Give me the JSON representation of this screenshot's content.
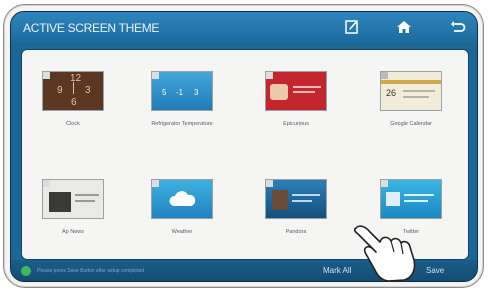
{
  "header": {
    "title": "ACTIVE SCREEN THEME",
    "icons": [
      "edit-icon",
      "home-icon",
      "back-icon"
    ]
  },
  "themes": [
    {
      "label": "Clock",
      "clock_digits": [
        "12",
        "9",
        "3",
        "6"
      ]
    },
    {
      "label": "Refrigerator Temperature",
      "temps": [
        "5",
        "-1",
        "3"
      ]
    },
    {
      "label": "Epicurious"
    },
    {
      "label": "Google Calendar",
      "day": "26"
    },
    {
      "label": "Ap News"
    },
    {
      "label": "Weather"
    },
    {
      "label": "Pandora"
    },
    {
      "label": "Twitter"
    }
  ],
  "footer": {
    "hint": "Please press Save Button after setup completed",
    "mark_all": "Mark All",
    "save": "Save"
  },
  "colors": {
    "accent": "#1d6796",
    "header": "#2a7fb5",
    "status_dot": "#3dbb5b",
    "panel": "#f5f5f3"
  }
}
